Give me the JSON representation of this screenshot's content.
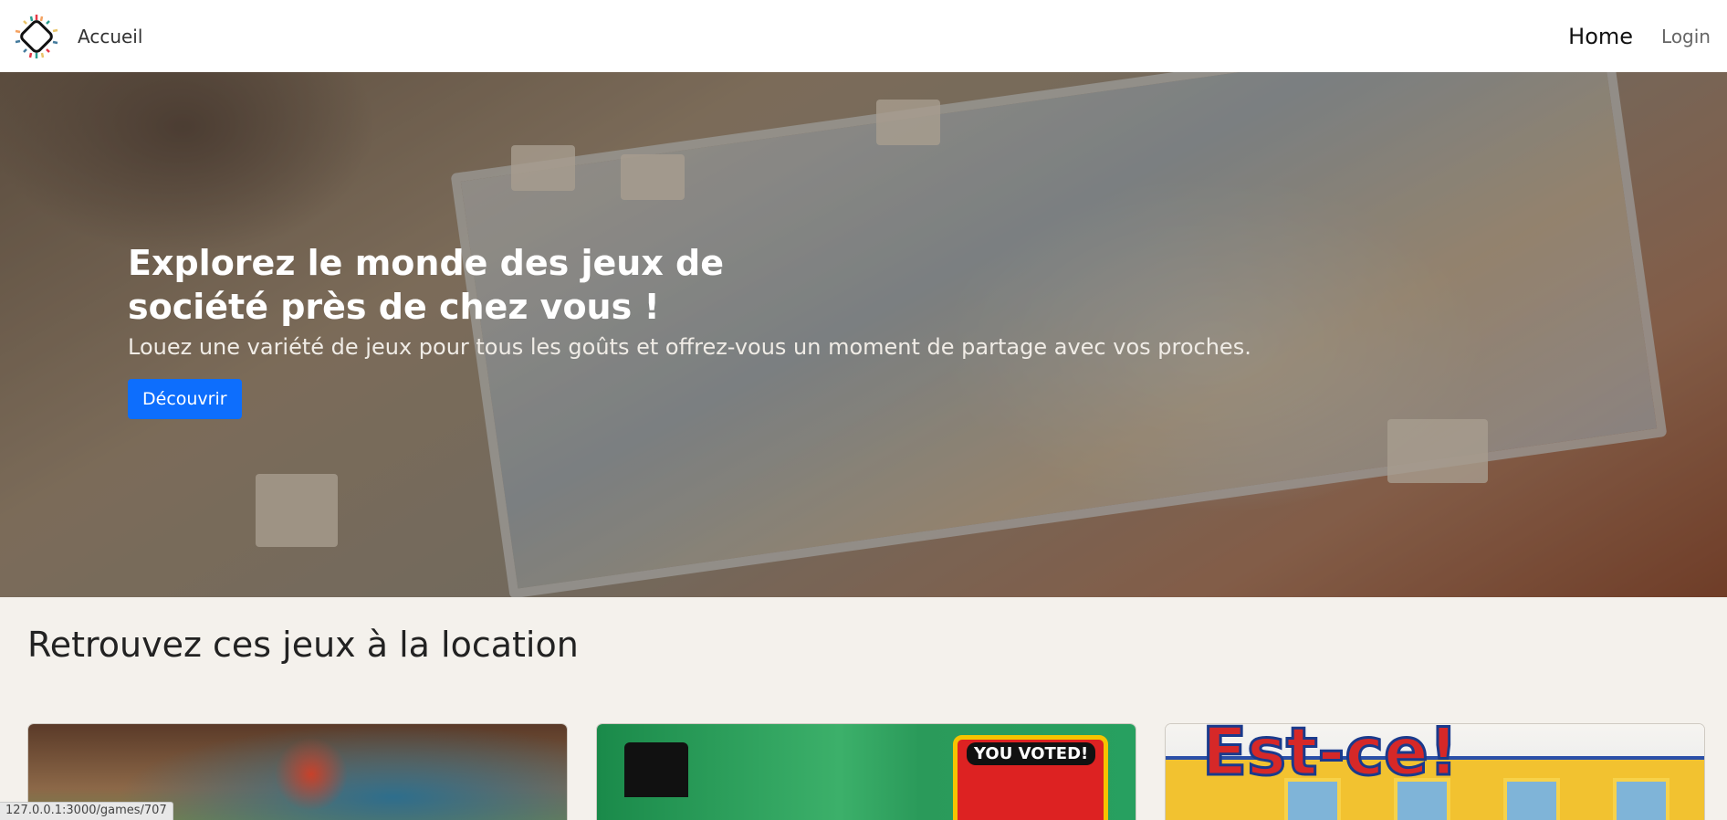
{
  "navbar": {
    "brand_label": "Accueil",
    "links": {
      "home": "Home",
      "login": "Login"
    }
  },
  "hero": {
    "title": "Explorez le monde des jeux de société près de chez vous !",
    "subtitle": "Louez une variété de jeux pour tous les goûts et offrez-vous un moment de partage avec vos proches.",
    "cta_label": "Découvrir"
  },
  "games_section": {
    "title": "Retrouvez ces jeux à la location",
    "cards": [
      {
        "image": "board-game-photo"
      },
      {
        "image": "monopoly-box",
        "badge": "YOU VOTED!"
      },
      {
        "image": "guess-who-box",
        "logo": "Est-ce!"
      }
    ]
  },
  "status_bar": {
    "url": "127.0.0.1:3000/games/707"
  },
  "colors": {
    "primary": "#0d6efd",
    "page_bg": "#f4f1ec",
    "navbar_bg": "#ffffff"
  }
}
